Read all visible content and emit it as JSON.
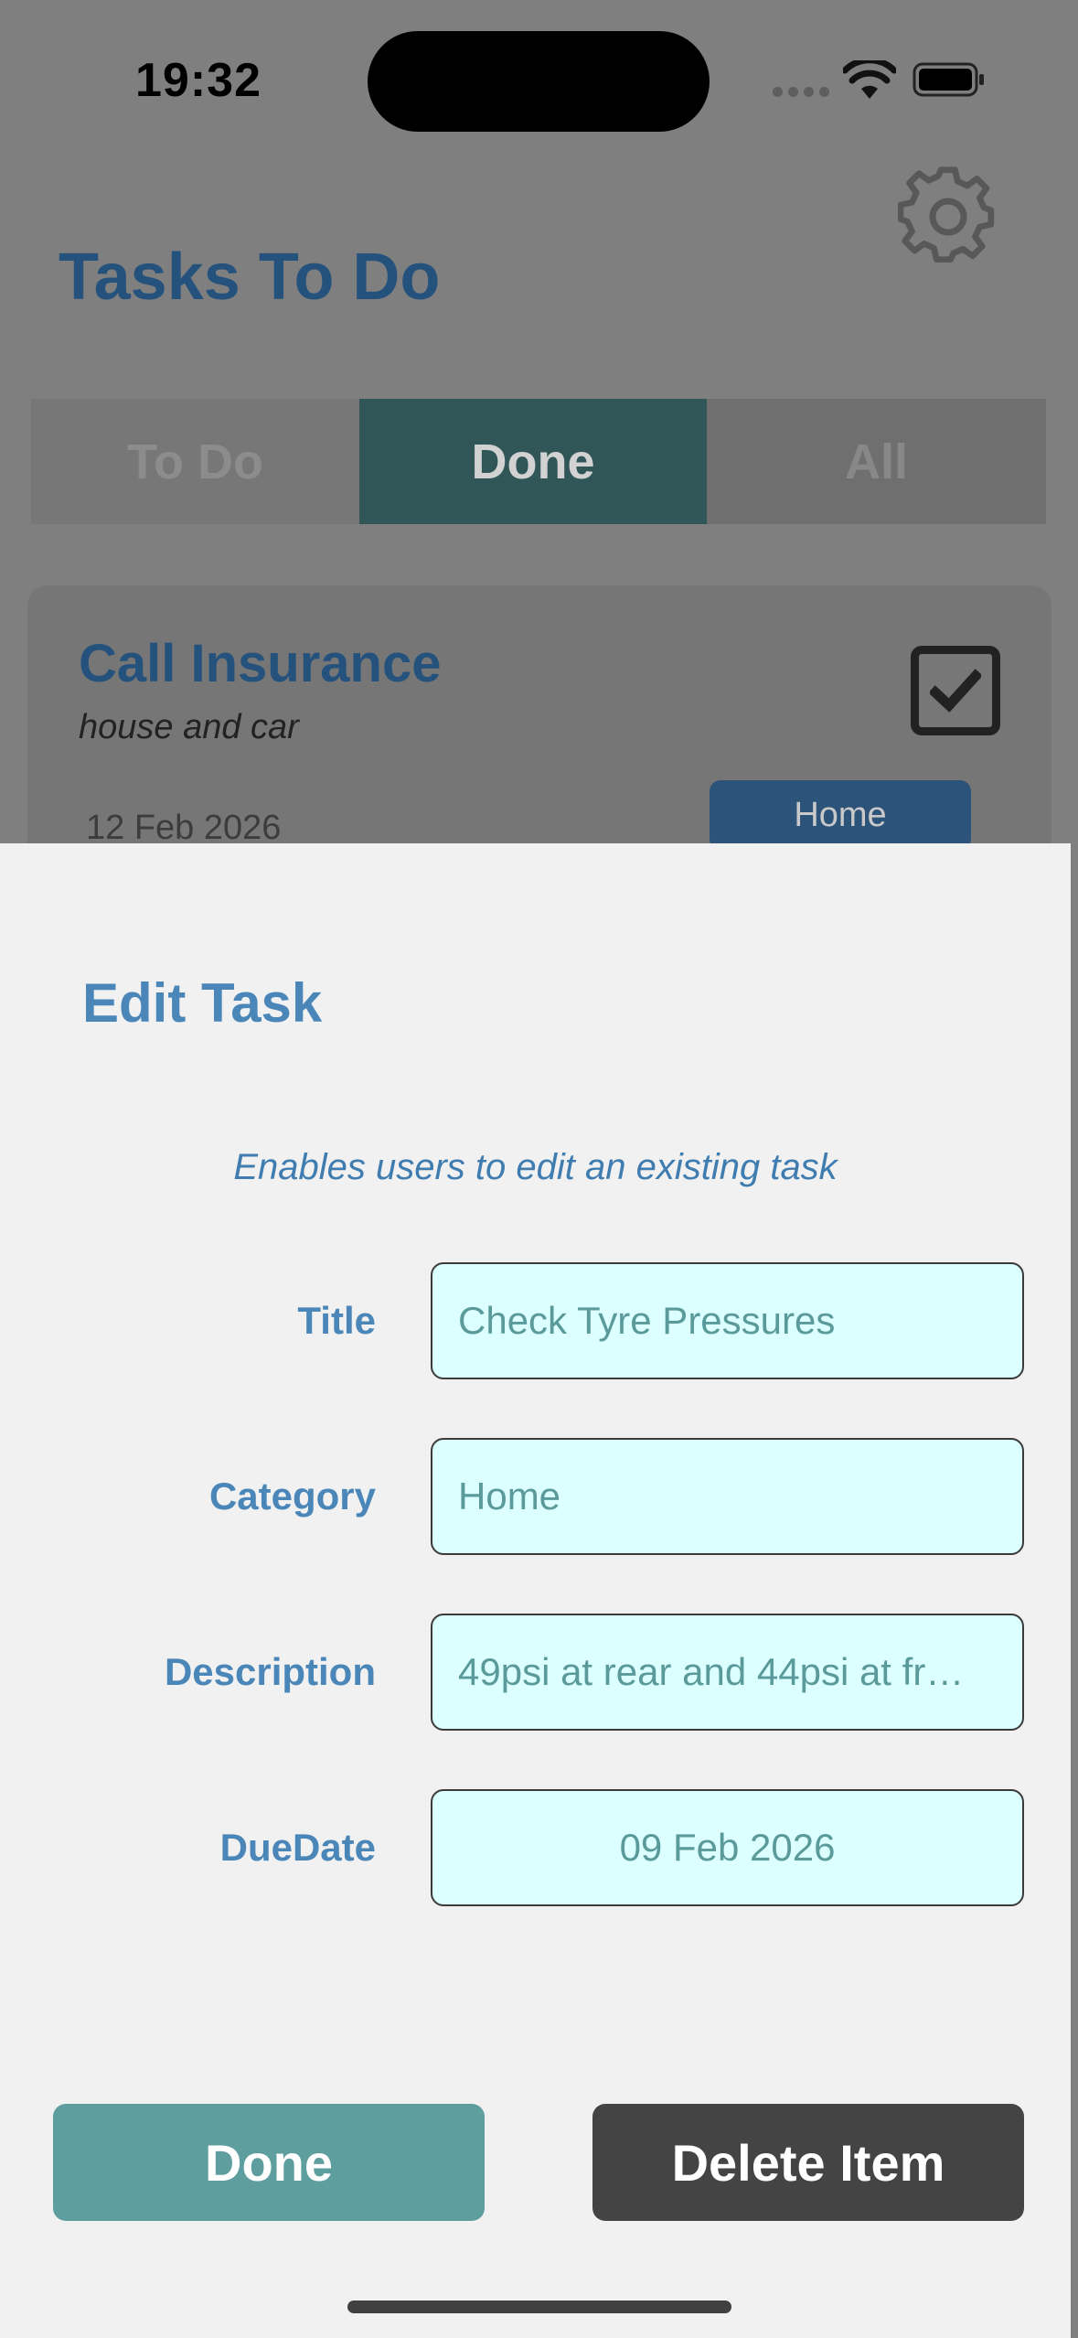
{
  "status_bar": {
    "time": "19:32"
  },
  "header": {
    "title": "Tasks To Do",
    "settings_icon": "gear-icon"
  },
  "segments": [
    {
      "label": "To Do",
      "selected": false
    },
    {
      "label": "Done",
      "selected": true
    },
    {
      "label": "All",
      "selected": false
    }
  ],
  "card": {
    "title": "Call Insurance",
    "description": "house and car",
    "date": "12 Feb 2026",
    "category": "Home",
    "checked": true
  },
  "sheet": {
    "title": "Edit Task",
    "subtitle": "Enables users to edit an existing task",
    "fields": {
      "title": {
        "label": "Title",
        "value": "Check Tyre Pressures"
      },
      "category": {
        "label": "Category",
        "value": "Home"
      },
      "description": {
        "label": "Description",
        "value": "49psi at rear and 44psi at fr…"
      },
      "due_date": {
        "label": "DueDate",
        "value": "09 Feb 2026"
      }
    },
    "done_label": "Done",
    "delete_label": "Delete Item"
  },
  "colors": {
    "accent": "#4a86b8",
    "field_bg": "#dcffff",
    "done_button": "#5f9e9f",
    "delete_button": "#444444",
    "selected_segment": "#315658"
  }
}
